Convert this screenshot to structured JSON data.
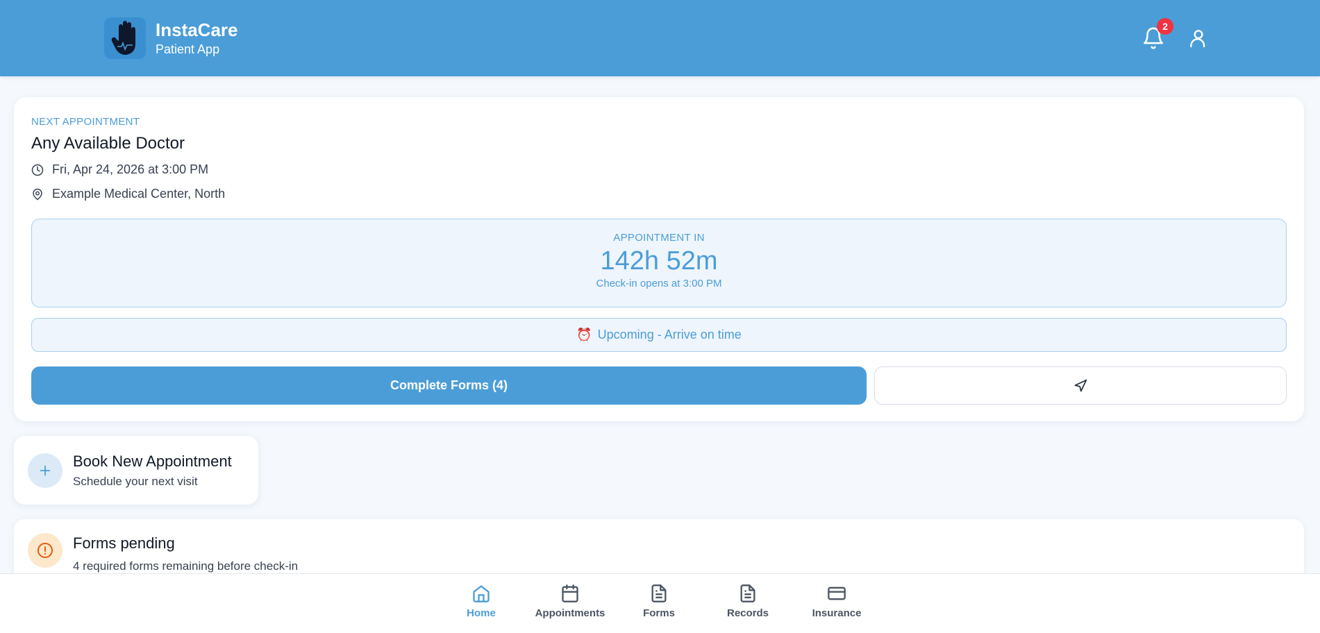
{
  "header": {
    "brand_title": "InstaCare",
    "brand_subtitle": "Patient App",
    "notification_count": "2",
    "logo_icon": "hand-icon",
    "colors": {
      "header_bg": "#4b9dd8",
      "badge": "#ef3340"
    }
  },
  "next_appointment": {
    "section_label": "NEXT APPOINTMENT",
    "doctor": "Any Available Doctor",
    "datetime": "Fri, Apr 24, 2026 at 3:00 PM",
    "location": "Example Medical Center, North",
    "countdown_label": "APPOINTMENT IN",
    "countdown_value": "142h 52m",
    "checkin_note": "Check-in opens at 3:00 PM",
    "status_emoji": "⏰",
    "status_text": "Upcoming - Arrive on time",
    "complete_forms_label": "Complete Forms (4)",
    "navigate_icon": "navigation-arrow-icon"
  },
  "book": {
    "title": "Book New Appointment",
    "subtitle": "Schedule your next visit"
  },
  "pending": {
    "title": "Forms pending",
    "subtitle": "4 required forms remaining before check-in"
  },
  "bottom_nav": {
    "active": "Home",
    "items": [
      {
        "label": "Home",
        "icon": "home-icon"
      },
      {
        "label": "Appointments",
        "icon": "calendar-icon"
      },
      {
        "label": "Forms",
        "icon": "document-icon"
      },
      {
        "label": "Records",
        "icon": "document-icon"
      },
      {
        "label": "Insurance",
        "icon": "credit-card-icon"
      }
    ]
  },
  "theme": {
    "accent": "#4b9dd8",
    "warning": "#e8590c"
  }
}
